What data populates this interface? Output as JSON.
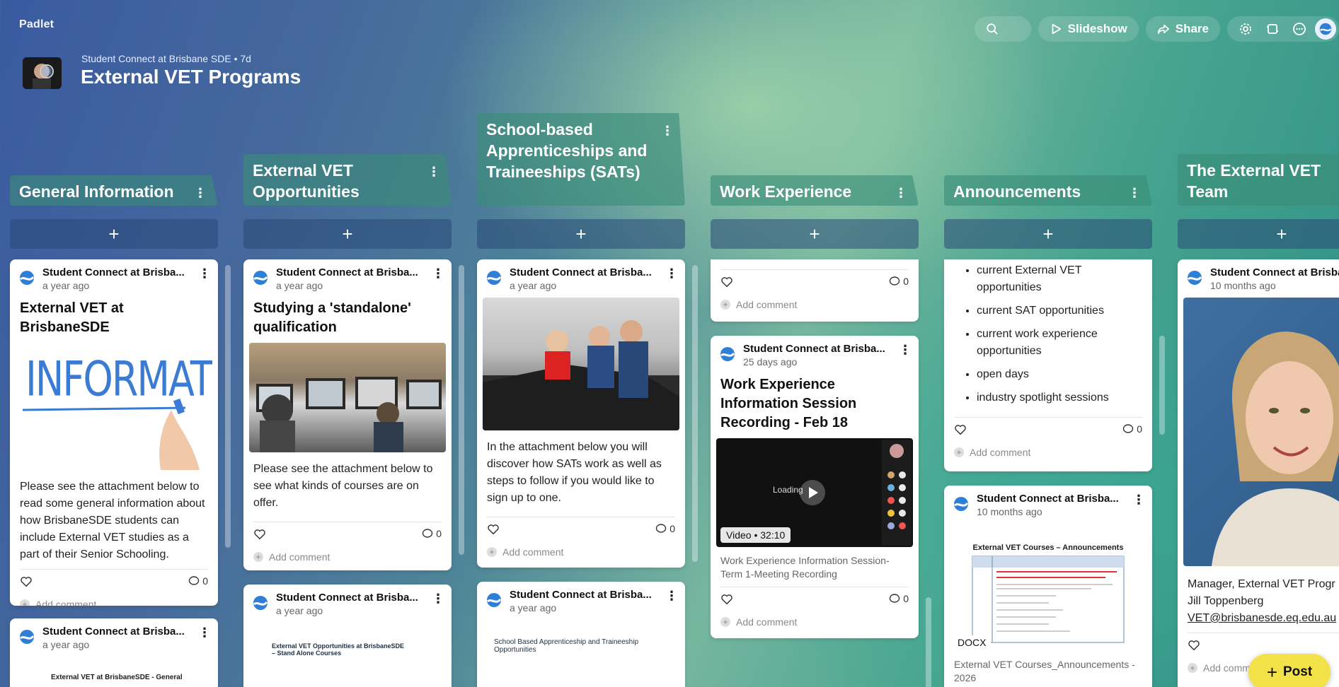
{
  "app": {
    "brand": "Padlet"
  },
  "toolbar": {
    "slideshow": "Slideshow",
    "share": "Share"
  },
  "header": {
    "subtitle": "Student Connect at Brisbane SDE • 7d",
    "title": "External VET Programs"
  },
  "columns": [
    {
      "title": "General Information"
    },
    {
      "title": "External VET Opportunities"
    },
    {
      "title": "School-based Apprenticeships and Traineeships (SATs)"
    },
    {
      "title": "Work Experience"
    },
    {
      "title": "Announcements"
    },
    {
      "title": "The External VET Team"
    }
  ],
  "add_label": "+",
  "add_comment": "Add comment",
  "cards": {
    "c1a": {
      "author": "Student Connect at Brisba...",
      "time": "a year ago",
      "title": "External VET at BrisbaneSDE",
      "image_text": "INFORMATION",
      "body": "Please see the attachment below to read some general information about how BrisbaneSDE students can include External VET studies as a part of their Senior Schooling.",
      "comments": "0"
    },
    "c1b": {
      "author": "Student Connect at Brisba...",
      "time": "a year ago",
      "doc_title": "External VET at BrisbaneSDE - General"
    },
    "c2a": {
      "author": "Student Connect at Brisba...",
      "time": "a year ago",
      "title": "Studying a 'standalone' qualification",
      "body": "Please see the attachment below to see what kinds of courses are on offer.",
      "comments": "0"
    },
    "c2b": {
      "author": "Student Connect at Brisba...",
      "time": "a year ago",
      "doc_title": "External VET Opportunities at BrisbaneSDE – Stand Alone Courses"
    },
    "c3a": {
      "author": "Student Connect at Brisba...",
      "time": "a year ago",
      "body": "In the attachment below you will discover how SATs work as well as steps to follow if you would like to sign up to one.",
      "comments": "0"
    },
    "c3b": {
      "author": "Student Connect at Brisba...",
      "time": "a year ago",
      "doc_title": "School Based Apprenticeship and Traineeship Opportunities"
    },
    "c4a": {
      "comments": "0"
    },
    "c4b": {
      "author": "Student Connect at Brisba...",
      "time": "25 days ago",
      "title": "Work Experience Information Session Recording - Feb 18",
      "loading": "Loading",
      "badge_type": "Video",
      "badge_duration": "32:10",
      "meta": "Work Experience Information Session-Term 1-Meeting Recording",
      "comments": "0"
    },
    "c5a": {
      "items": [
        "current External VET opportunities",
        "current SAT opportunities",
        "current work experience opportunities",
        "open days",
        "industry spotlight sessions"
      ],
      "comments": "0"
    },
    "c5b": {
      "author": "Student Connect at Brisba...",
      "time": "10 months ago",
      "doc_title": "External VET Courses – Announcements",
      "badge": "DOCX",
      "meta": "External VET Courses_Announcements - 2026"
    },
    "c6a": {
      "author": "Student Connect at Brisba...",
      "time": "10 months ago",
      "meta1": "Manager, External VET Progr",
      "meta2": "Jill Toppenberg",
      "meta3": "VET@brisbanesde.eq.edu.au",
      "add_comment": "Add comm"
    }
  },
  "post_button": "Post",
  "colors": {
    "card": "#ffffff",
    "header_tint": "#3a8c78",
    "post": "#f3e14a"
  }
}
